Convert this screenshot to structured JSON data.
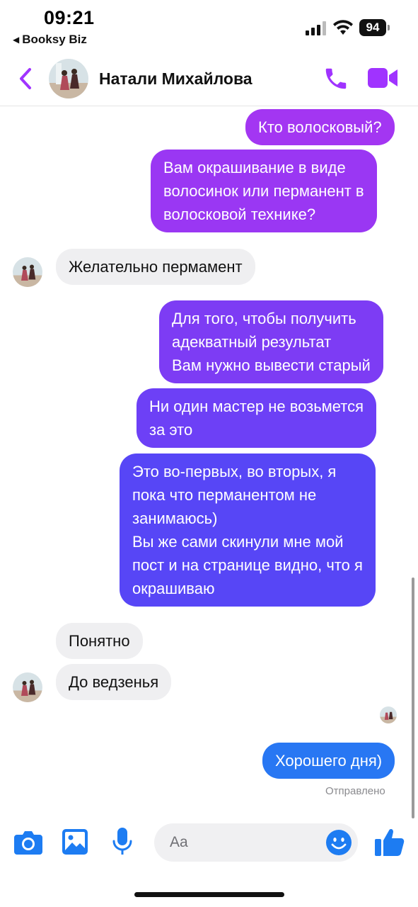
{
  "status_bar": {
    "time": "09:21",
    "back_app": "Booksy Biz",
    "battery": "94",
    "icons": [
      "cellular-signal-icon",
      "wifi-icon",
      "battery-icon"
    ]
  },
  "header": {
    "contact_name": "Натали Михайлова",
    "icons": [
      "back-chevron-icon",
      "phone-icon",
      "video-camera-icon"
    ],
    "accent_color": "#a033ff"
  },
  "messages": [
    {
      "from": "me",
      "text": "Кто волосковый?"
    },
    {
      "from": "me",
      "text": "Вам окрашивание в виде\nволосинок или перманент в\nволосковой технике?"
    },
    {
      "from": "contact",
      "text": "Желательно пермамент"
    },
    {
      "from": "me",
      "text": "Для того, чтобы получить\nадекватный результат\nВам нужно вывести старый"
    },
    {
      "from": "me",
      "text": "Ни один мастер не возьмется\nза это"
    },
    {
      "from": "me",
      "text": "Это во-первых, во вторых, я\nпока что перманентом не\nзанимаюсь)\nВы же сами скинули мне мой\nпост и на странице видно, что я\nокрашиваю"
    },
    {
      "from": "contact",
      "text": "Понятно"
    },
    {
      "from": "contact",
      "text": "До ведзенья"
    },
    {
      "from": "me",
      "text": "Хорошего дня)"
    }
  ],
  "sent_status": "Отправлено",
  "bubble_colors": {
    "m1": "#a336f2",
    "m2": "#9a37f3",
    "m4": "#7d3cf4",
    "m5": "#6d40f6",
    "m6": "#5746f6",
    "m9": "#2877f3",
    "incoming": "#efeff1"
  },
  "composer": {
    "placeholder": "Aa",
    "icons": [
      "camera-icon",
      "gallery-icon",
      "microphone-icon",
      "emoji-icon",
      "thumbs-up-icon"
    ],
    "icon_color": "#1d7cf2"
  }
}
